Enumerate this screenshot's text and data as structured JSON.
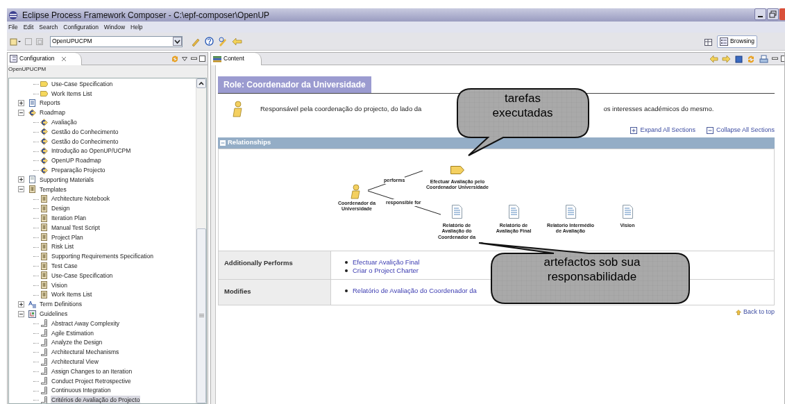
{
  "window": {
    "title": "Eclipse Process Framework Composer - C:\\epf-composer\\OpenUP"
  },
  "menu": [
    "File",
    "Edit",
    "Search",
    "Configuration",
    "Window",
    "Help"
  ],
  "toolbar": {
    "configuration": "OpenUPUCPM",
    "perspective": "Browsing"
  },
  "left_view": {
    "tab": "Configuration",
    "configuration": "OpenUPUCPM",
    "tree": {
      "continued": [
        {
          "label": "Use-Case Specification",
          "kind": "artifact",
          "selected": false
        },
        {
          "label": "Work Items List",
          "kind": "artifact",
          "selected": false
        }
      ],
      "items": [
        {
          "label": "Reports",
          "kind": "report",
          "expanded": false,
          "selected": false
        },
        {
          "label": "Roadmap",
          "kind": "roadmap",
          "expanded": true,
          "selected": false,
          "children": [
            {
              "label": "Avaliação",
              "kind": "roadmap",
              "selected": false
            },
            {
              "label": "Gestão do Conhecimento",
              "kind": "roadmap",
              "selected": false
            },
            {
              "label": "Gestão do Conhecimento",
              "kind": "roadmap",
              "selected": false
            },
            {
              "label": "Introdução ao OpenUP/UCPM",
              "kind": "roadmap",
              "selected": false
            },
            {
              "label": "OpenUP Roadmap",
              "kind": "roadmap",
              "selected": false
            },
            {
              "label": "Preparação Projecto",
              "kind": "roadmap",
              "selected": false
            }
          ]
        },
        {
          "label": "Supporting Materials",
          "kind": "supporting",
          "expanded": false,
          "selected": false
        },
        {
          "label": "Templates",
          "kind": "template",
          "expanded": true,
          "selected": false,
          "children": [
            {
              "label": "Architecture Notebook",
              "kind": "template",
              "selected": false
            },
            {
              "label": "Design",
              "kind": "template",
              "selected": false
            },
            {
              "label": "Iteration Plan",
              "kind": "template",
              "selected": false
            },
            {
              "label": "Manual Test Script",
              "kind": "template",
              "selected": false
            },
            {
              "label": "Project Plan",
              "kind": "template",
              "selected": false
            },
            {
              "label": "Risk List",
              "kind": "template",
              "selected": false
            },
            {
              "label": "Supporting Requirements Specification",
              "kind": "template",
              "selected": false
            },
            {
              "label": "Test Case",
              "kind": "template",
              "selected": false
            },
            {
              "label": "Use-Case Specification",
              "kind": "template",
              "selected": false
            },
            {
              "label": "Vision",
              "kind": "template",
              "selected": false
            },
            {
              "label": "Work Items List",
              "kind": "template",
              "selected": false
            }
          ]
        },
        {
          "label": "Term Definitions",
          "kind": "terms",
          "expanded": false,
          "selected": false
        },
        {
          "label": "Guidelines",
          "kind": "guidelines",
          "expanded": true,
          "selected": false,
          "children": [
            {
              "label": "Abstract Away Complexity",
              "kind": "guideline",
              "selected": false
            },
            {
              "label": "Agile Estimation",
              "kind": "guideline",
              "selected": false
            },
            {
              "label": "Analyze the Design",
              "kind": "guideline",
              "selected": false
            },
            {
              "label": "Architectural Mechanisms",
              "kind": "guideline",
              "selected": false
            },
            {
              "label": "Architectural View",
              "kind": "guideline",
              "selected": false
            },
            {
              "label": "Assign Changes to an Iteration",
              "kind": "guideline",
              "selected": false
            },
            {
              "label": "Conduct Project Retrospective",
              "kind": "guideline",
              "selected": false
            },
            {
              "label": "Continuous Integration",
              "kind": "guideline",
              "selected": false
            },
            {
              "label": "Critérios de Avaliação do Projecto",
              "kind": "guideline",
              "selected": true
            }
          ]
        }
      ]
    }
  },
  "content_view": {
    "tab": "Content",
    "role_title": "Role: Coordenador da Universidade",
    "description": [
      "Responsável pela coordenação do projecto, do lado da",
      "os interesses académicos do mesmo."
    ],
    "expand_all": "Expand All Sections",
    "collapse_all": "Collapse All Sections",
    "relationships": {
      "title": "Relationships",
      "expanded": true,
      "role": "Coordenador da Universidade",
      "performs_label": "performs",
      "responsible_label": "responsible for",
      "tasks": [
        "Efectuar Avaliação pelo Coordenador Universidade"
      ],
      "artifacts": [
        "Relatório de Avaliação do Coordenador da",
        "Relatório de Avaliação Final",
        "Relatorio Intermédio de Avaliação",
        "Vision"
      ]
    },
    "sections": [
      {
        "label": "Additionally Performs",
        "links": [
          "Efectuar Avalição Final",
          "Criar o Project Charter"
        ]
      },
      {
        "label": "Modifies",
        "links": [
          "Relatório de Avaliação do Coordenador da"
        ]
      }
    ],
    "back_to_top": "Back to top"
  },
  "callouts": [
    {
      "lines": [
        "tarefas",
        "executadas"
      ]
    },
    {
      "lines": [
        "artefactos sob sua",
        "responsabilidade"
      ]
    }
  ]
}
